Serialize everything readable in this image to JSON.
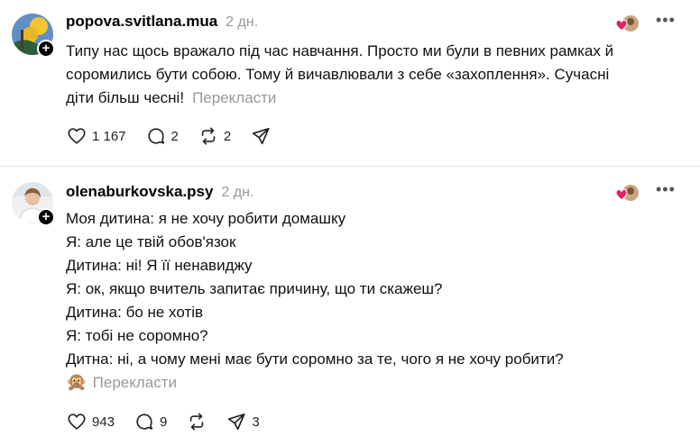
{
  "posts": [
    {
      "username": "popova.svitlana.mua",
      "time": "2 дн.",
      "lines": [
        "Типу нас щось вражало під час навчання. Просто ми були в певних рамках й",
        "соромились бути собою. Тому й вичавлювали з себе «захоплення». Сучасні",
        "діти більш чесні!"
      ],
      "translate_label": "Перекласти",
      "likes": "1 167",
      "comments": "2",
      "reposts": "2",
      "shares": ""
    },
    {
      "username": "olenaburkovska.psy",
      "time": "2 дн.",
      "lines": [
        "Моя дитина: я не хочу робити домашку",
        "Я: але це твій обов'язок",
        "Дитина: ні! Я її ненавиджу",
        "Я: ок, якщо вчитель запитає причину, що ти скажеш?",
        "Дитина: бо не хотів",
        "Я: тобі не соромно?",
        "Дитна: ні, а чому мені має бути соромно за те, чого я не хочу робити?"
      ],
      "emoji": "🙊",
      "translate_label": "Перекласти",
      "likes": "943",
      "comments": "9",
      "reposts": "",
      "shares": "3"
    }
  ],
  "more_label": "•••",
  "follow_label": "+",
  "colors": {
    "muted": "#999999",
    "heart": "#e0245e",
    "icon": "#222222"
  }
}
